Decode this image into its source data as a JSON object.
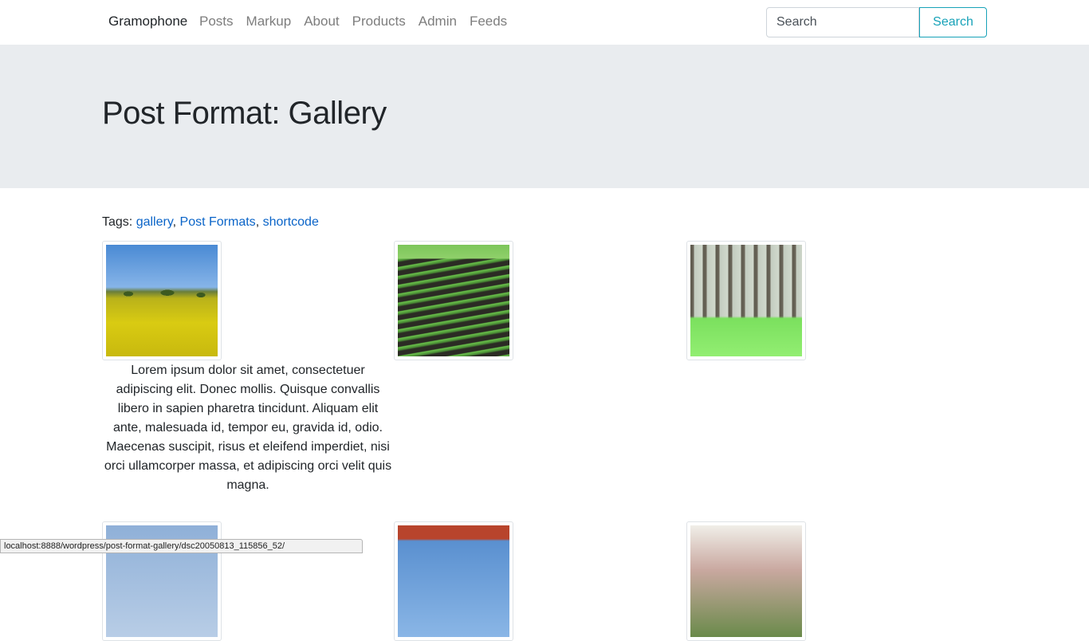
{
  "navbar": {
    "brand": "Gramophone",
    "links": [
      "Posts",
      "Markup",
      "About",
      "Products",
      "Admin",
      "Feeds"
    ],
    "search_placeholder": "Search",
    "search_button": "Search"
  },
  "page": {
    "title": "Post Format: Gallery"
  },
  "tags": {
    "label": "Tags:",
    "items": [
      "gallery",
      "Post Formats",
      "shortcode"
    ]
  },
  "gallery": {
    "caption": "Lorem ipsum dolor sit amet, consectetuer adipiscing elit. Donec mollis. Quisque convallis libero in sapien pharetra tincidunt. Aliquam elit ante, malesuada id, tempor eu, gravida id, odio. Maecenas suscipit, risus et eleifend imperdiet, nisi orci ullamcorper massa, et adipiscing orci velit quis magna."
  },
  "status_bar": {
    "url": "localhost:8888/wordpress/post-format-gallery/dsc20050813_115856_52/"
  }
}
